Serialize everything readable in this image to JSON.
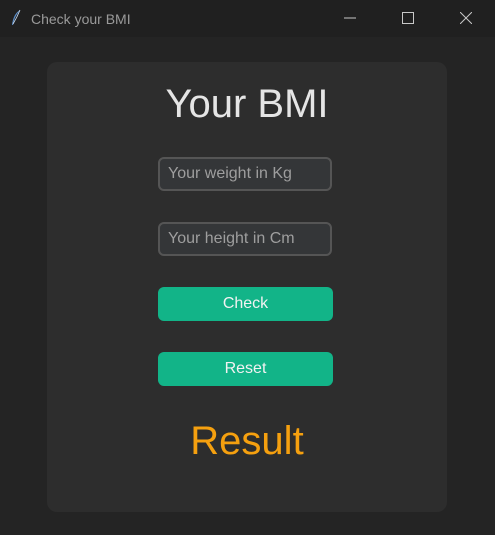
{
  "window": {
    "title": "Check your BMI",
    "icons": {
      "app": "feather-icon",
      "minimize": "minimize-icon",
      "maximize": "maximize-icon",
      "close": "close-icon"
    }
  },
  "form": {
    "heading": "Your BMI",
    "weight": {
      "placeholder": "Your weight in Kg",
      "value": ""
    },
    "height": {
      "placeholder": "Your height in Cm",
      "value": ""
    },
    "check_label": "Check",
    "reset_label": "Reset",
    "result_text": "Result"
  },
  "colors": {
    "background": "#242424",
    "card": "#2d2d2d",
    "accent": "#12b488",
    "result": "#f5a00f",
    "heading": "#e5e5e5"
  }
}
